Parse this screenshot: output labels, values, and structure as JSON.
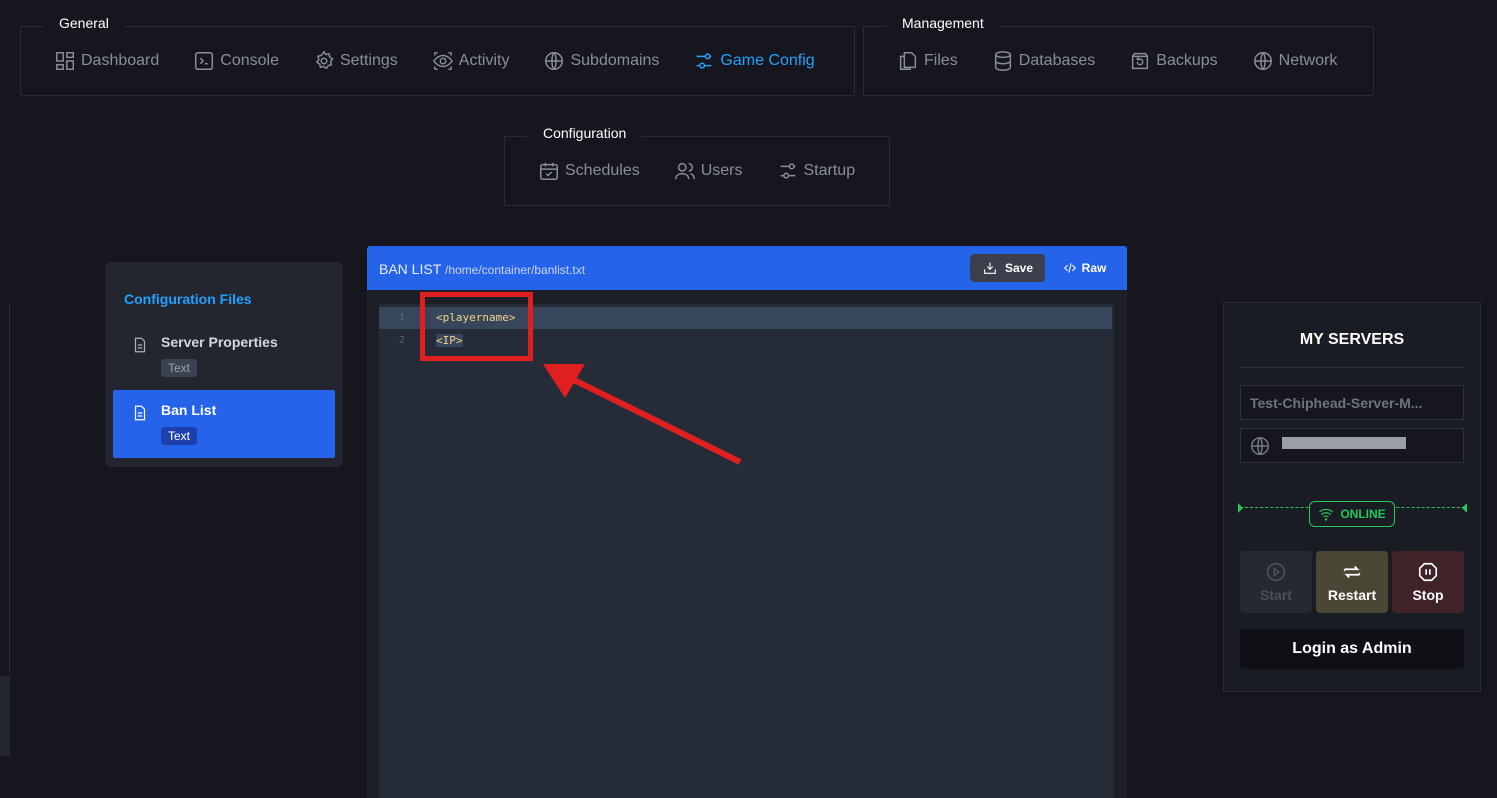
{
  "nav": {
    "general": {
      "legend": "General",
      "items": [
        {
          "label": "Dashboard",
          "icon": "dashboard-icon"
        },
        {
          "label": "Console",
          "icon": "terminal-icon"
        },
        {
          "label": "Settings",
          "icon": "gear-icon"
        },
        {
          "label": "Activity",
          "icon": "eye-icon"
        },
        {
          "label": "Subdomains",
          "icon": "globe-icon"
        },
        {
          "label": "Game Config",
          "icon": "sliders-icon",
          "active": true
        }
      ]
    },
    "management": {
      "legend": "Management",
      "items": [
        {
          "label": "Files",
          "icon": "files-icon"
        },
        {
          "label": "Databases",
          "icon": "database-icon"
        },
        {
          "label": "Backups",
          "icon": "backup-icon"
        },
        {
          "label": "Network",
          "icon": "globe-icon"
        }
      ]
    },
    "configuration": {
      "legend": "Configuration",
      "items": [
        {
          "label": "Schedules",
          "icon": "calendar-icon"
        },
        {
          "label": "Users",
          "icon": "users-icon"
        },
        {
          "label": "Startup",
          "icon": "sliders-icon"
        }
      ]
    }
  },
  "config_files": {
    "title": "Configuration Files",
    "items": [
      {
        "name": "Server Properties",
        "badge": "Text"
      },
      {
        "name": "Ban List",
        "badge": "Text",
        "active": true
      }
    ]
  },
  "editor": {
    "title": "BAN LIST",
    "path": "/home/container/banlist.txt",
    "save_label": "Save",
    "raw_label": "Raw",
    "lines": [
      {
        "num": "1",
        "text": "<playername>"
      },
      {
        "num": "2",
        "text": "<IP>"
      }
    ]
  },
  "servers": {
    "header": "MY SERVERS",
    "server_name": "Test-Chiphead-Server-M...",
    "status": "ONLINE",
    "start_label": "Start",
    "restart_label": "Restart",
    "stop_label": "Stop",
    "login_label": "Login as Admin"
  },
  "colors": {
    "accent": "#2563eb",
    "link": "#1fa3ff",
    "online": "#22c55e",
    "annotation": "#e02020"
  }
}
